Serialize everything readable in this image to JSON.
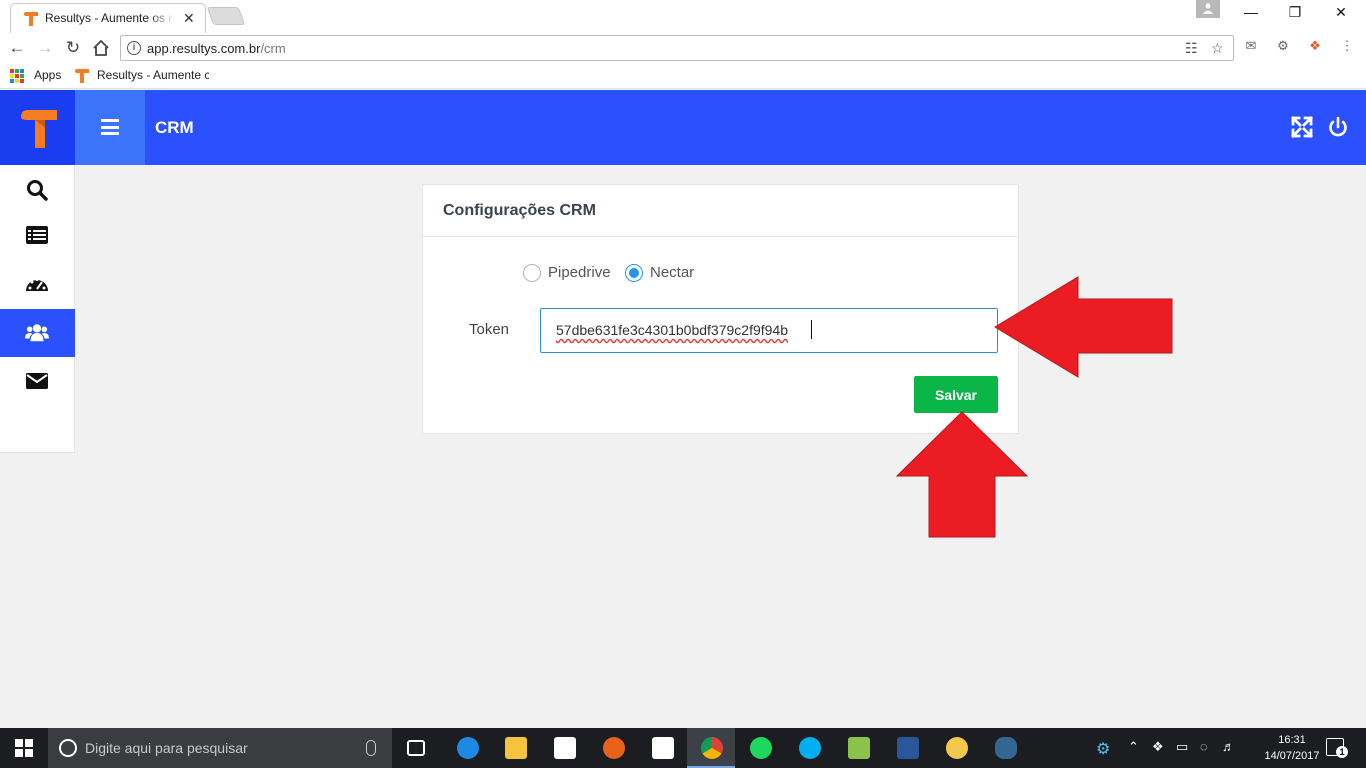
{
  "browser": {
    "tab_title": "Resultys - Aumente os resultados",
    "tab_close": "✕",
    "url_host": "app.resultys.com.br",
    "url_path": "/crm",
    "bookmarks": [
      {
        "label": "Apps"
      },
      {
        "label": "Resultys - Aumente c"
      }
    ],
    "window_controls": {
      "minimize": "—",
      "restore": "❐",
      "close": "✕"
    }
  },
  "app": {
    "header_title": "CRM",
    "brand_color": "#2b50fe",
    "sidebar_items": [
      {
        "name": "search",
        "icon": "search-icon",
        "active": false
      },
      {
        "name": "list",
        "icon": "list-icon",
        "active": false
      },
      {
        "name": "dashboard",
        "icon": "dashboard-icon",
        "active": false
      },
      {
        "name": "users",
        "icon": "users-icon",
        "active": true
      },
      {
        "name": "mail",
        "icon": "envelope-icon",
        "active": false
      }
    ]
  },
  "crm_settings": {
    "title": "Configurações CRM",
    "options": [
      {
        "label": "Pipedrive",
        "checked": false
      },
      {
        "label": "Nectar",
        "checked": true
      }
    ],
    "token_label": "Token",
    "token_value": "57dbe631fe3c4301b0bdf379c2f9f94b",
    "save_label": "Salvar",
    "save_color": "#0ab548"
  },
  "annotation": {
    "arrow_color": "#ec1c24"
  },
  "taskbar": {
    "search_placeholder": "Digite aqui para pesquisar",
    "time": "16:31",
    "date": "14/07/2017",
    "notification_count": "1"
  }
}
